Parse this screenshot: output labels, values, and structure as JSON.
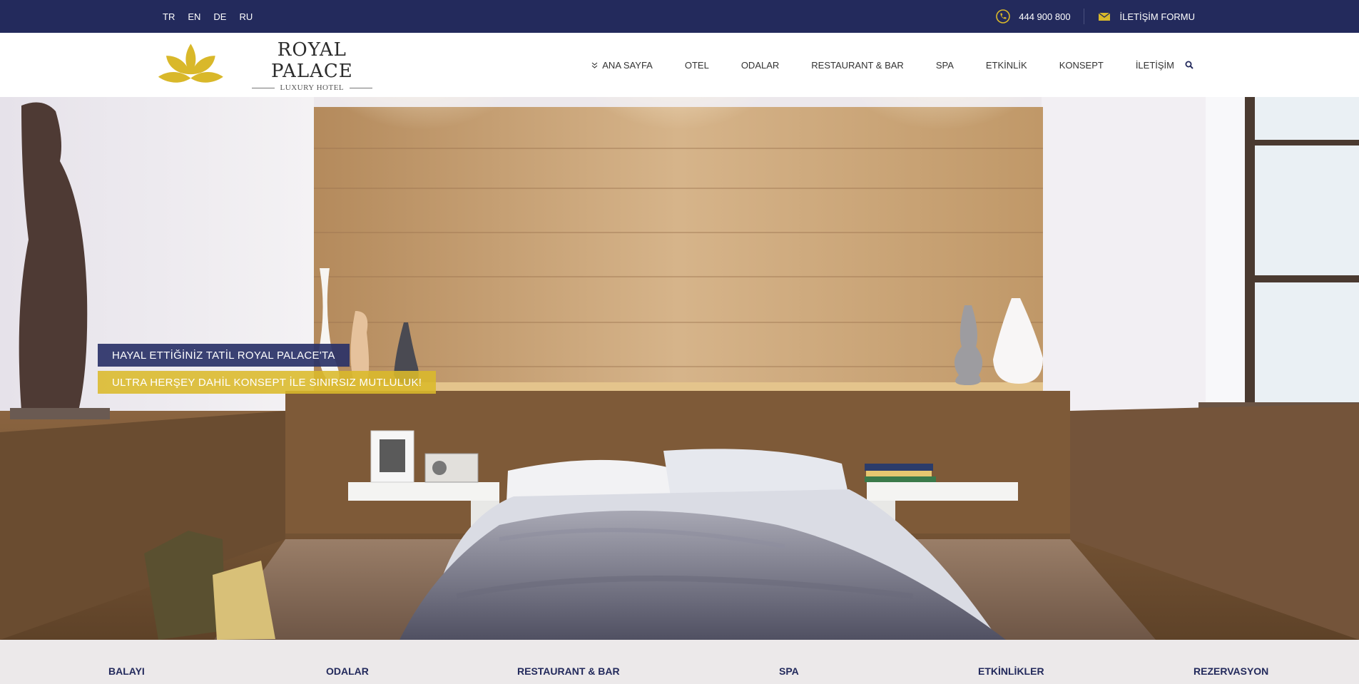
{
  "topbar": {
    "languages": [
      "TR",
      "EN",
      "DE",
      "RU"
    ],
    "phone_icon": "phone-icon",
    "phone": "444 900 800",
    "mail_icon": "envelope-icon",
    "contact_form": "İLETİŞİM FORMU"
  },
  "brand": {
    "logo_icon": "lotus-icon",
    "name": "ROYAL PALACE",
    "tagline": "LUXURY HOTEL",
    "gold": "#d9b82a",
    "navy": "#232a5c"
  },
  "nav": {
    "items": [
      "ANA SAYFA",
      "OTEL",
      "ODALAR",
      "RESTAURANT & BAR",
      "SPA",
      "ETKİNLİK",
      "KONSEPT",
      "İLETİŞİM"
    ],
    "search_icon": "search-icon"
  },
  "hero": {
    "headline": "HAYAL ETTİĞİNİZ TATİL ROYAL PALACE'TA",
    "subline": "ULTRA HERŞEY DAHİL KONSEPT İLE SINIRSIZ MUTLULUK!"
  },
  "features": [
    "BALAYI",
    "ODALAR",
    "RESTAURANT & BAR",
    "SPA",
    "ETKİNLİKLER",
    "REZERVASYON"
  ]
}
